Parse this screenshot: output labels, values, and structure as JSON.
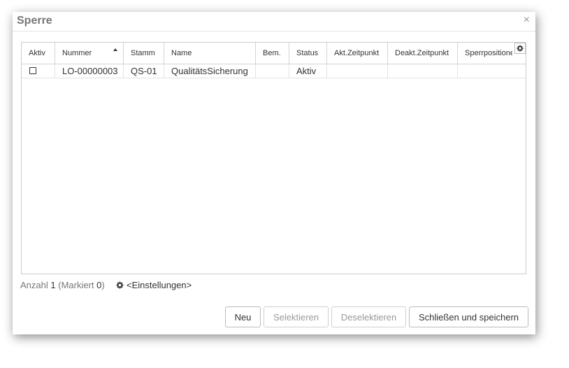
{
  "dialog": {
    "title": "Sperre",
    "close_symbol": "×"
  },
  "grid": {
    "columns": [
      "Aktiv",
      "Nummer",
      "Stamm",
      "Name",
      "Bem.",
      "Status",
      "Akt.Zeitpunkt",
      "Deakt.Zeitpunkt",
      "Sperrpositionen"
    ],
    "sorted_column": "Nummer",
    "sort_direction": "ascending",
    "settings_icon": "gear-icon",
    "rows": [
      {
        "aktiv": false,
        "nummer": "LO-00000003",
        "stamm": "QS-01",
        "name": "QualitätsSicherung",
        "bem": "",
        "status": "Aktiv",
        "akt_zeitpunkt": "",
        "deakt_zeitpunkt": "",
        "sperrpositionen": ""
      }
    ]
  },
  "footer": {
    "count_label": "Anzahl",
    "count": "1",
    "marked_open": "(Markiert",
    "marked": "0",
    "marked_close": ")",
    "settings_label": "<Einstellungen>",
    "settings_icon": "gear-icon"
  },
  "buttons": {
    "new": "Neu",
    "select": "Selektieren",
    "deselect": "Deselektieren",
    "close_save": "Schließen und speichern"
  },
  "colors": {
    "title": "#777777",
    "text": "#333333",
    "muted": "#999999",
    "border": "#cccccc"
  }
}
